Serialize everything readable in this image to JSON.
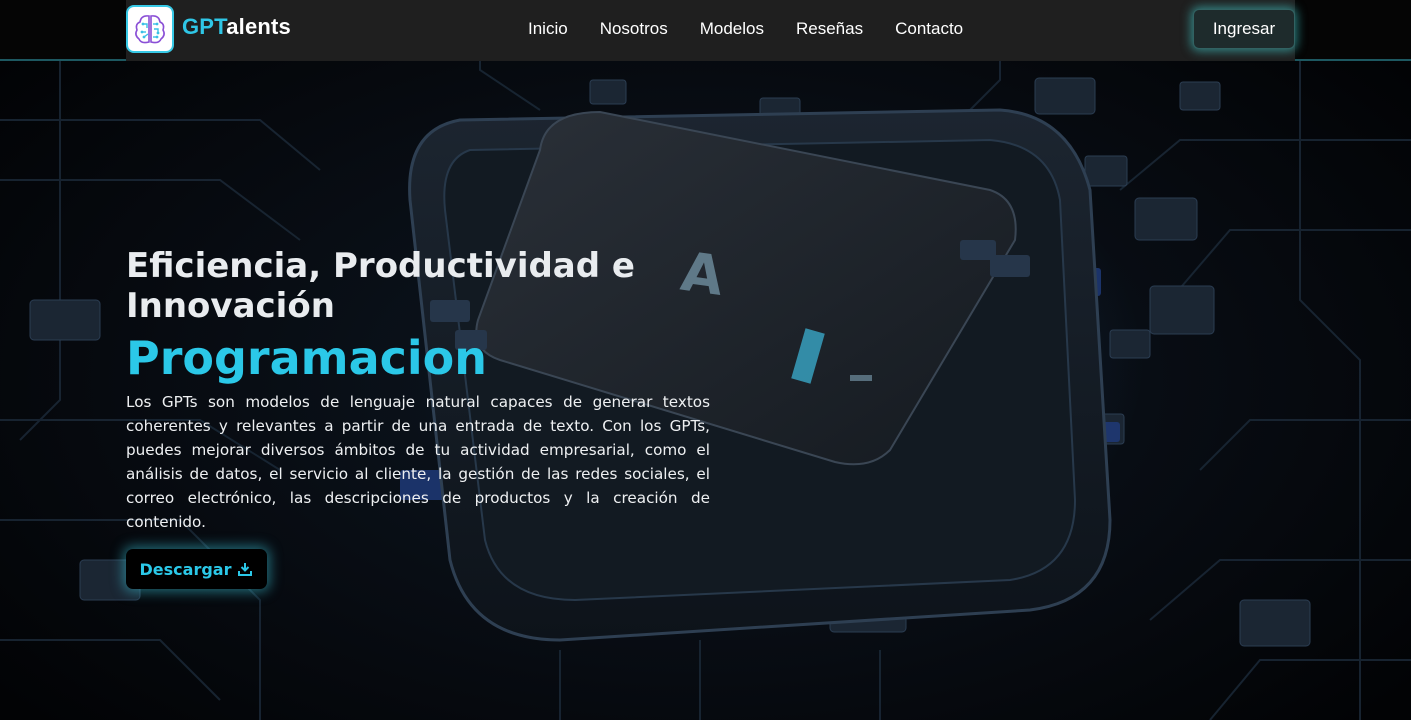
{
  "header": {
    "brand_part1": "GPT",
    "brand_part2": "alents",
    "nav": [
      {
        "label": "Inicio"
      },
      {
        "label": "Nosotros"
      },
      {
        "label": "Modelos"
      },
      {
        "label": "Reseñas"
      },
      {
        "label": "Contacto"
      }
    ],
    "login_label": "Ingresar"
  },
  "hero": {
    "title": "Eficiencia, Productividad e Innovación",
    "subtitle": "Programacion",
    "description": "Los GPTs son modelos de lenguaje natural capaces de generar textos coherentes y relevantes a partir de una entrada de texto. Con los GPTs, puedes mejorar diversos ámbitos de tu actividad empresarial, como el análisis de datos, el servicio al cliente, la gestión de las redes sociales, el correo electrónico, las descripciones de productos y la creación de contenido.",
    "download_label": "Descargar",
    "download_icon": "download-icon",
    "chip_letters": "A I"
  },
  "colors": {
    "accent": "#2bc8e8",
    "header_bg": "#1f1f1f",
    "button_glow": "#46dcdc"
  }
}
